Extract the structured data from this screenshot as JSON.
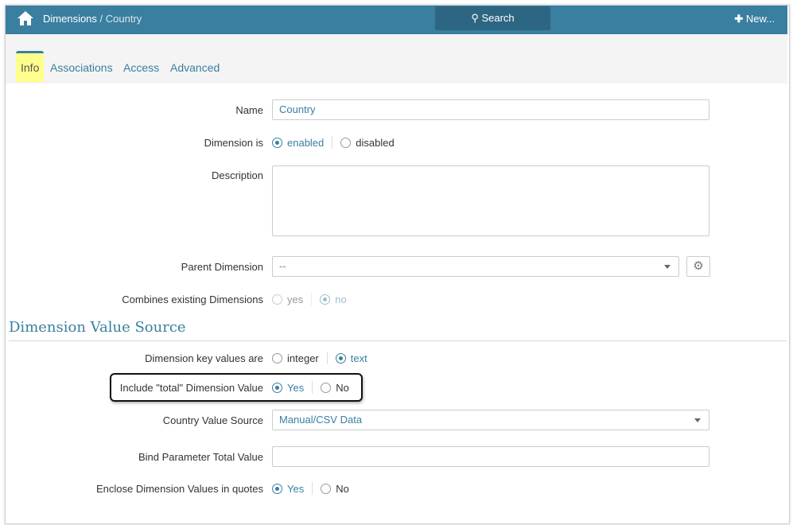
{
  "header": {
    "crumb_parent": "Dimensions",
    "crumb_sep": " / ",
    "crumb_current": "Country",
    "search_label": "Search",
    "new_label": "New..."
  },
  "tabs": [
    "Info",
    "Associations",
    "Access",
    "Advanced"
  ],
  "form": {
    "name_label": "Name",
    "name_value": "Country",
    "dim_is_label": "Dimension is",
    "enabled": "enabled",
    "disabled": "disabled",
    "desc_label": "Description",
    "desc_value": "",
    "parent_label": "Parent Dimension",
    "parent_value": "--",
    "combines_label": "Combines existing Dimensions",
    "yes_l": "yes",
    "no_l": "no",
    "section_title": "Dimension Value Source",
    "key_label": "Dimension key values are",
    "integer": "integer",
    "text": "text",
    "total_label": "Include \"total\" Dimension Value",
    "yes": "Yes",
    "no": "No",
    "source_label": "Country Value Source",
    "source_value": "Manual/CSV Data",
    "bind_label": "Bind Parameter Total Value",
    "bind_value": "",
    "enclose_label": "Enclose Dimension Values in quotes"
  }
}
